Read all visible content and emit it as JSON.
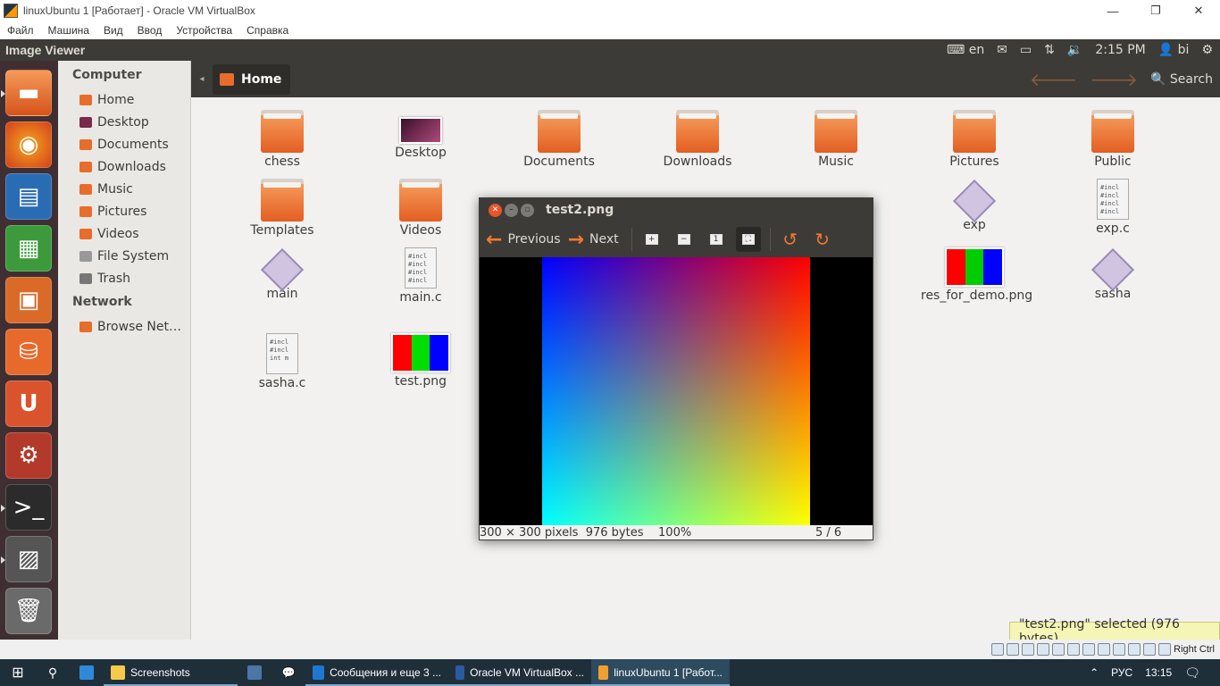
{
  "vbox": {
    "title": "linuxUbuntu 1 [Работает] - Oracle VM VirtualBox",
    "menu": [
      "Файл",
      "Машина",
      "Вид",
      "Ввод",
      "Устройства",
      "Справка"
    ],
    "controls": {
      "minimize": "—",
      "maximize": "❐",
      "close": "✕"
    },
    "status": {
      "host_key": "Right Ctrl"
    }
  },
  "panel": {
    "app_name": "Image Viewer",
    "keyboard": "en",
    "time": "2:15 PM",
    "user": "bi"
  },
  "nautilus": {
    "breadcrumb": "Home",
    "search_label": "Search",
    "sidebar": {
      "computer_heading": "Computer",
      "computer_items": [
        {
          "label": "Home",
          "color": "#e86c2c"
        },
        {
          "label": "Desktop",
          "color": "#7a2a4a"
        },
        {
          "label": "Documents",
          "color": "#e86c2c"
        },
        {
          "label": "Downloads",
          "color": "#e86c2c"
        },
        {
          "label": "Music",
          "color": "#e86c2c"
        },
        {
          "label": "Pictures",
          "color": "#e86c2c"
        },
        {
          "label": "Videos",
          "color": "#e86c2c"
        },
        {
          "label": "File System",
          "color": "#999999"
        },
        {
          "label": "Trash",
          "color": "#777777"
        }
      ],
      "network_heading": "Network",
      "network_items": [
        {
          "label": "Browse Net…",
          "color": "#e86c2c"
        }
      ]
    },
    "files": [
      {
        "name": "chess",
        "kind": "folder"
      },
      {
        "name": "Desktop",
        "kind": "desktop"
      },
      {
        "name": "Documents",
        "kind": "folder"
      },
      {
        "name": "Downloads",
        "kind": "folder"
      },
      {
        "name": "Music",
        "kind": "folder"
      },
      {
        "name": "Pictures",
        "kind": "folder"
      },
      {
        "name": "Public",
        "kind": "folder"
      },
      {
        "name": "Templates",
        "kind": "folder"
      },
      {
        "name": "Videos",
        "kind": "folder"
      },
      {
        "name": "exp",
        "kind": "exec"
      },
      {
        "name": "exp.c",
        "kind": "text"
      },
      {
        "name": "main",
        "kind": "exec"
      },
      {
        "name": "main.c",
        "kind": "text"
      },
      {
        "name": "res_for_demo.png",
        "kind": "image"
      },
      {
        "name": "sasha",
        "kind": "exec"
      },
      {
        "name": "sasha.c",
        "kind": "text"
      },
      {
        "name": "test.png",
        "kind": "image"
      }
    ],
    "code_snippet": "#incl",
    "code_snippet_b": "int m",
    "selection_status": "\"test2.png\" selected (976 bytes)"
  },
  "viewer": {
    "title": "test2.png",
    "previous_label": "Previous",
    "next_label": "Next",
    "status_dims": "300 × 300 pixels",
    "status_size": "976 bytes",
    "status_zoom": "100%",
    "status_position": "5 / 6"
  },
  "launcher": [
    "files-icon",
    "firefox-icon",
    "writer-icon",
    "calc-icon",
    "impress-icon",
    "software-center-icon",
    "ubuntu-one-icon",
    "system-settings-icon",
    "terminal-icon",
    "image-viewer-icon",
    "trash-icon"
  ],
  "taskbar": {
    "items": [
      "Screenshots",
      "Сообщения и еще 3 ...",
      "Oracle VM VirtualBox ...",
      "linuxUbuntu 1 [Работ..."
    ],
    "lang": "РУС",
    "time": "13:15"
  }
}
